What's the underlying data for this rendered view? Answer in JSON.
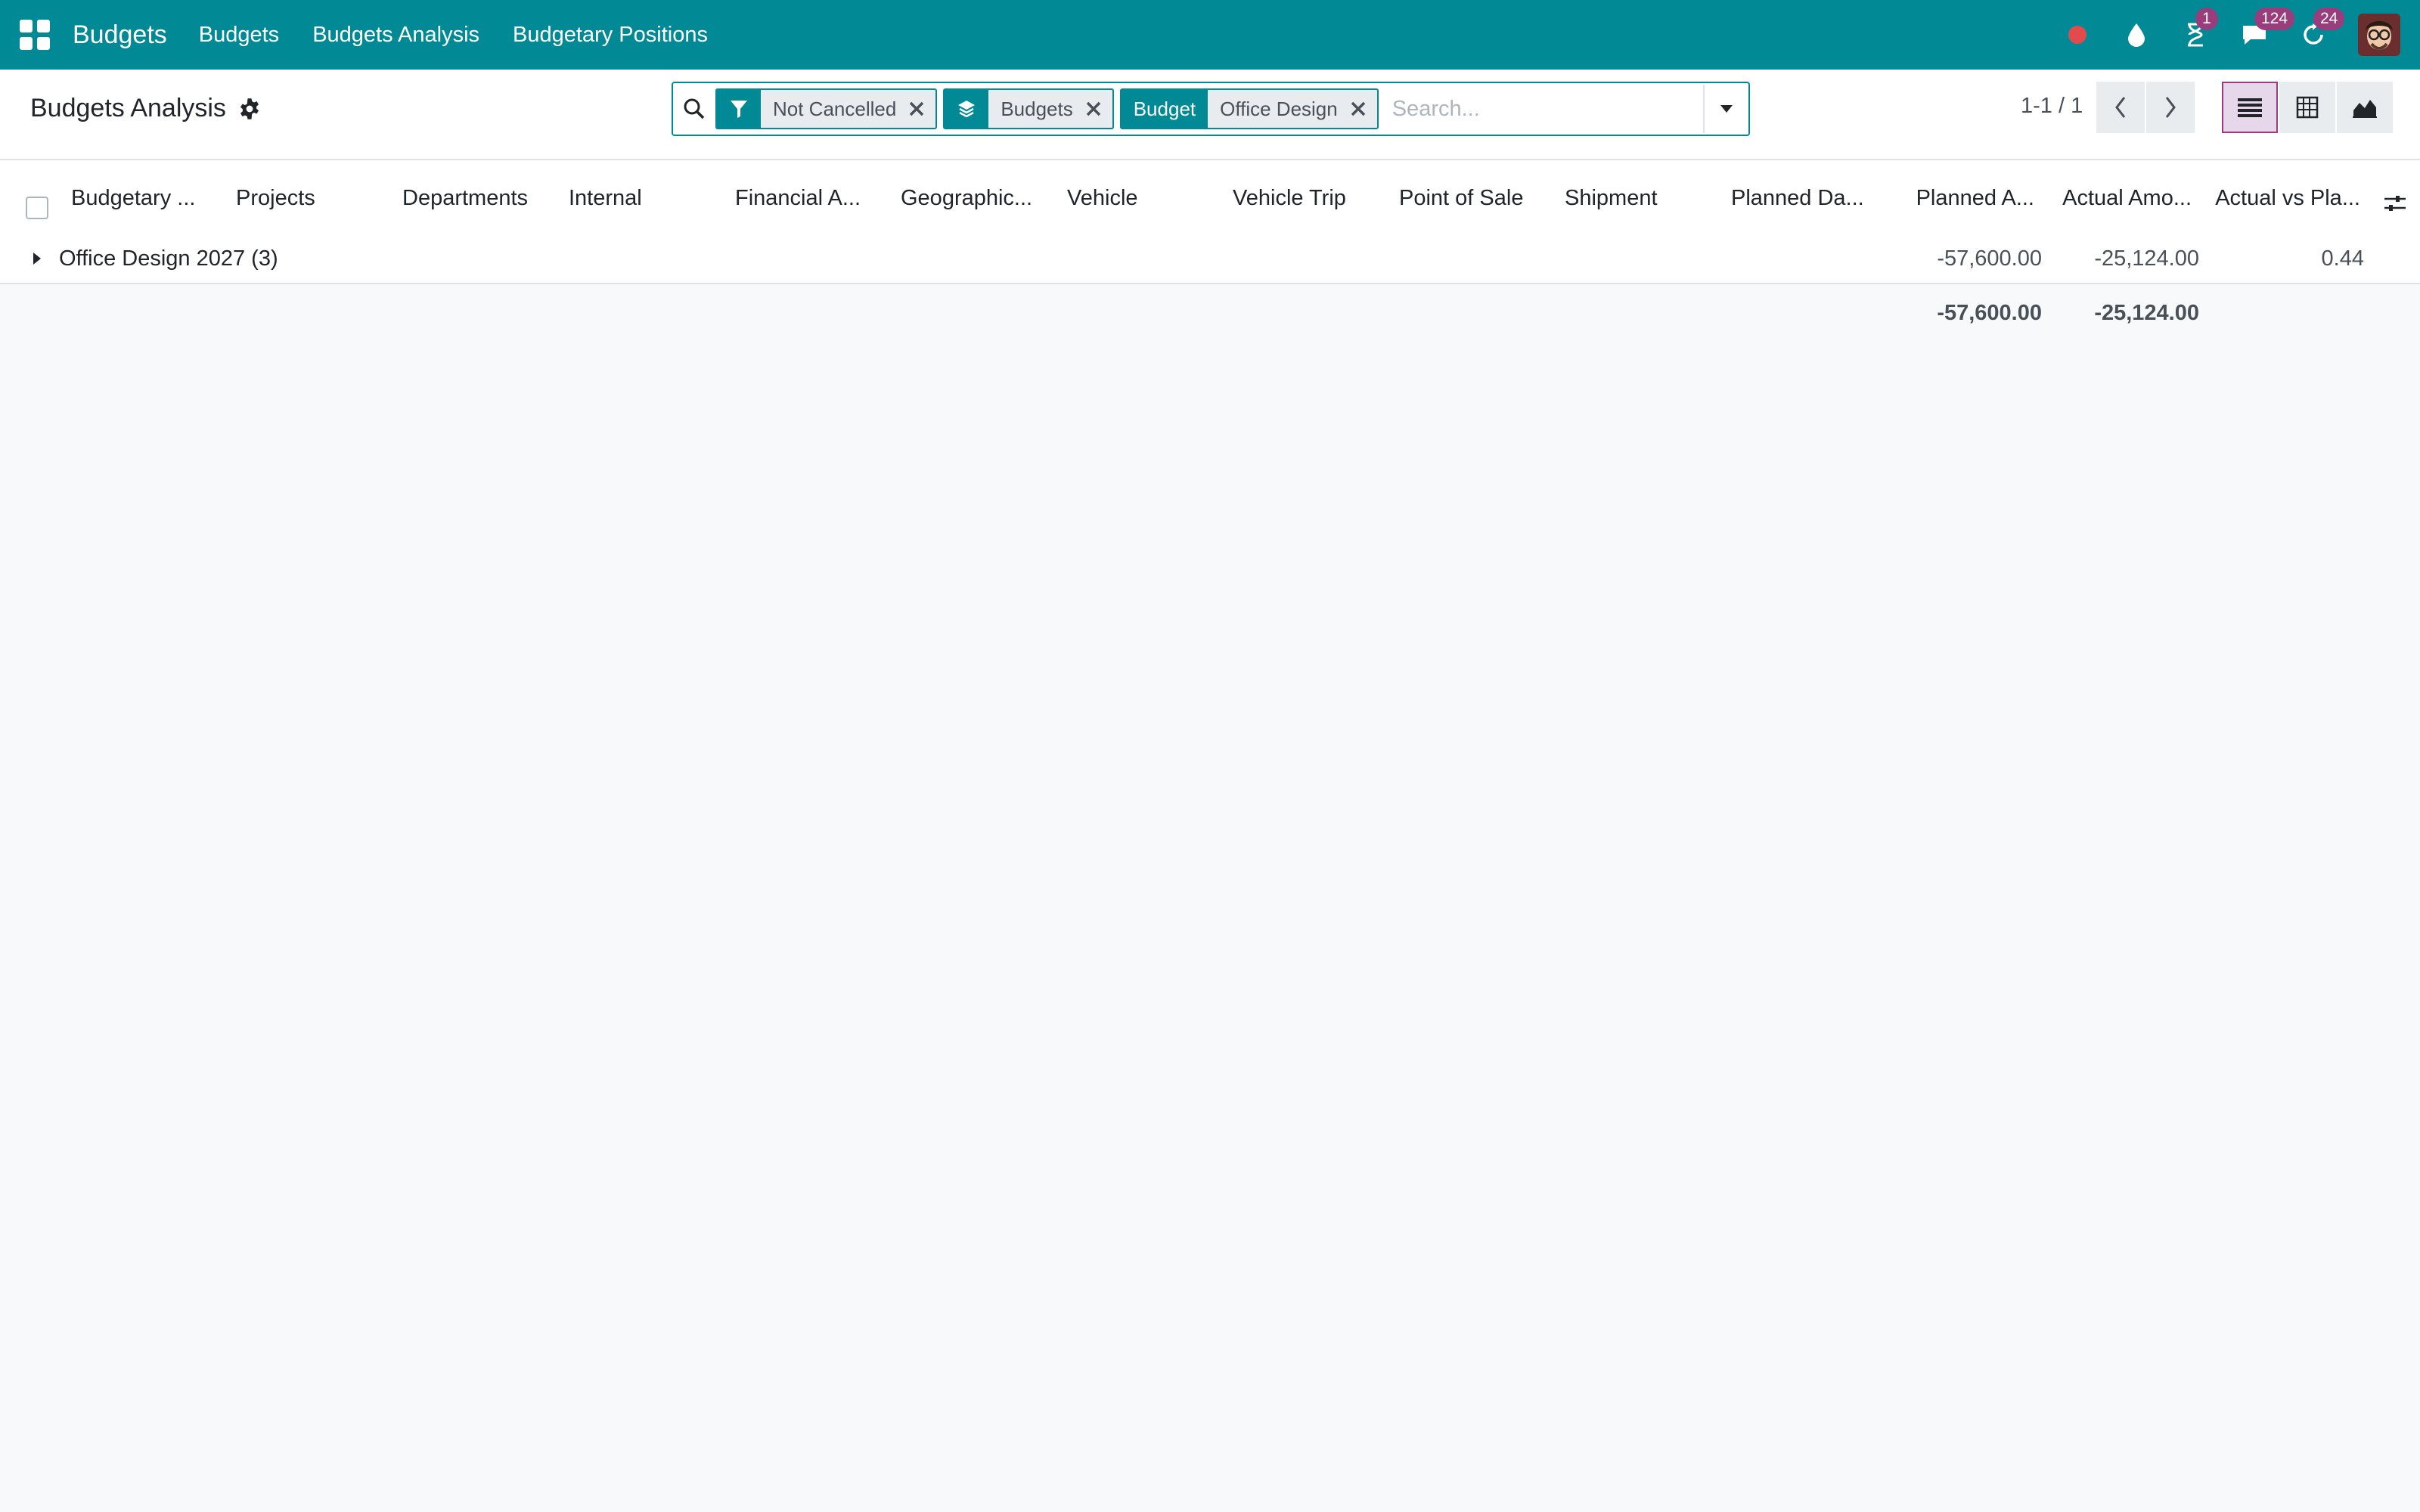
{
  "navbar": {
    "brand": "Budgets",
    "menus": [
      "Budgets",
      "Budgets Analysis",
      "Budgetary Positions"
    ],
    "activities_badge": "1",
    "messages_badge": "124",
    "updates_badge": "24",
    "accent_color": "#018a96",
    "badge_color": "#9a3d7c"
  },
  "breadcrumb": {
    "title": "Budgets Analysis"
  },
  "search": {
    "placeholder": "Search...",
    "facets": [
      {
        "icon": "filter-icon",
        "value": "Not Cancelled"
      },
      {
        "icon": "layers-icon",
        "value": "Budgets"
      },
      {
        "label": "Budget",
        "value": "Office Design"
      }
    ]
  },
  "pager": {
    "value": "1-1 / 1"
  },
  "views": [
    "list-view",
    "pivot-view",
    "graph-view"
  ],
  "table": {
    "columns": [
      "Budgetary ...",
      "Projects",
      "Departments",
      "Internal",
      "Financial A...",
      "Geographic...",
      "Vehicle",
      "Vehicle Trip",
      "Point of Sale",
      "Shipment",
      "Planned Da...",
      "Planned A...",
      "Actual Amo...",
      "Actual vs Pla..."
    ],
    "group": {
      "name": "Office Design 2027 (3)",
      "planned_amount": "-57,600.00",
      "actual_amount": "-25,124.00",
      "actual_vs_planned": "0.44"
    },
    "totals": {
      "planned_amount": "-57,600.00",
      "actual_amount": "-25,124.00"
    }
  }
}
